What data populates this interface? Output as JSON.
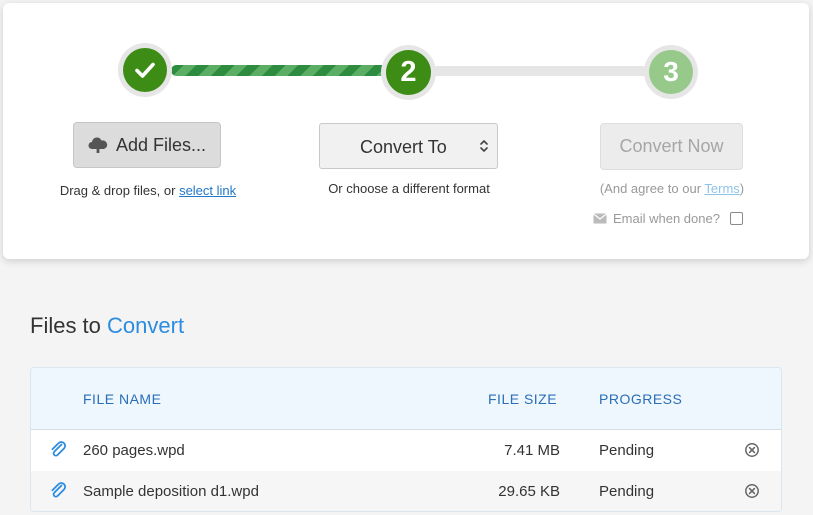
{
  "steps": [
    {
      "number": "",
      "state": "done",
      "icon": "check-icon"
    },
    {
      "number": "2",
      "state": "active"
    },
    {
      "number": "3",
      "state": "pending"
    }
  ],
  "add_files": {
    "label": "Add Files...",
    "icon": "cloud-upload-icon"
  },
  "drag_drop": {
    "text": "Drag & drop files, or ",
    "link": "select link"
  },
  "convert_to": {
    "label": "Convert To",
    "icon": "chevron-updown-icon"
  },
  "different_format": "Or choose a different format",
  "convert_now": {
    "label": "Convert Now"
  },
  "agree": {
    "prefix": "(And agree to our ",
    "terms": "Terms",
    "suffix": ")"
  },
  "email": {
    "label": "Email when done?",
    "icon": "envelope-icon",
    "checked": false
  },
  "files_section": {
    "title_prefix": "Files to ",
    "title_accent": "Convert"
  },
  "table": {
    "headers": {
      "name": "FILE NAME",
      "size": "FILE SIZE",
      "progress": "PROGRESS"
    },
    "rows": [
      {
        "name": "260 pages.wpd",
        "size": "7.41 MB",
        "progress": "Pending"
      },
      {
        "name": "Sample deposition d1.wpd",
        "size": "29.65 KB",
        "progress": "Pending"
      }
    ]
  },
  "colors": {
    "step_done": "#3c8c16",
    "step_pending": "#96c98a",
    "accent_blue": "#2b8ce0",
    "header_text": "#2a6eb8"
  }
}
